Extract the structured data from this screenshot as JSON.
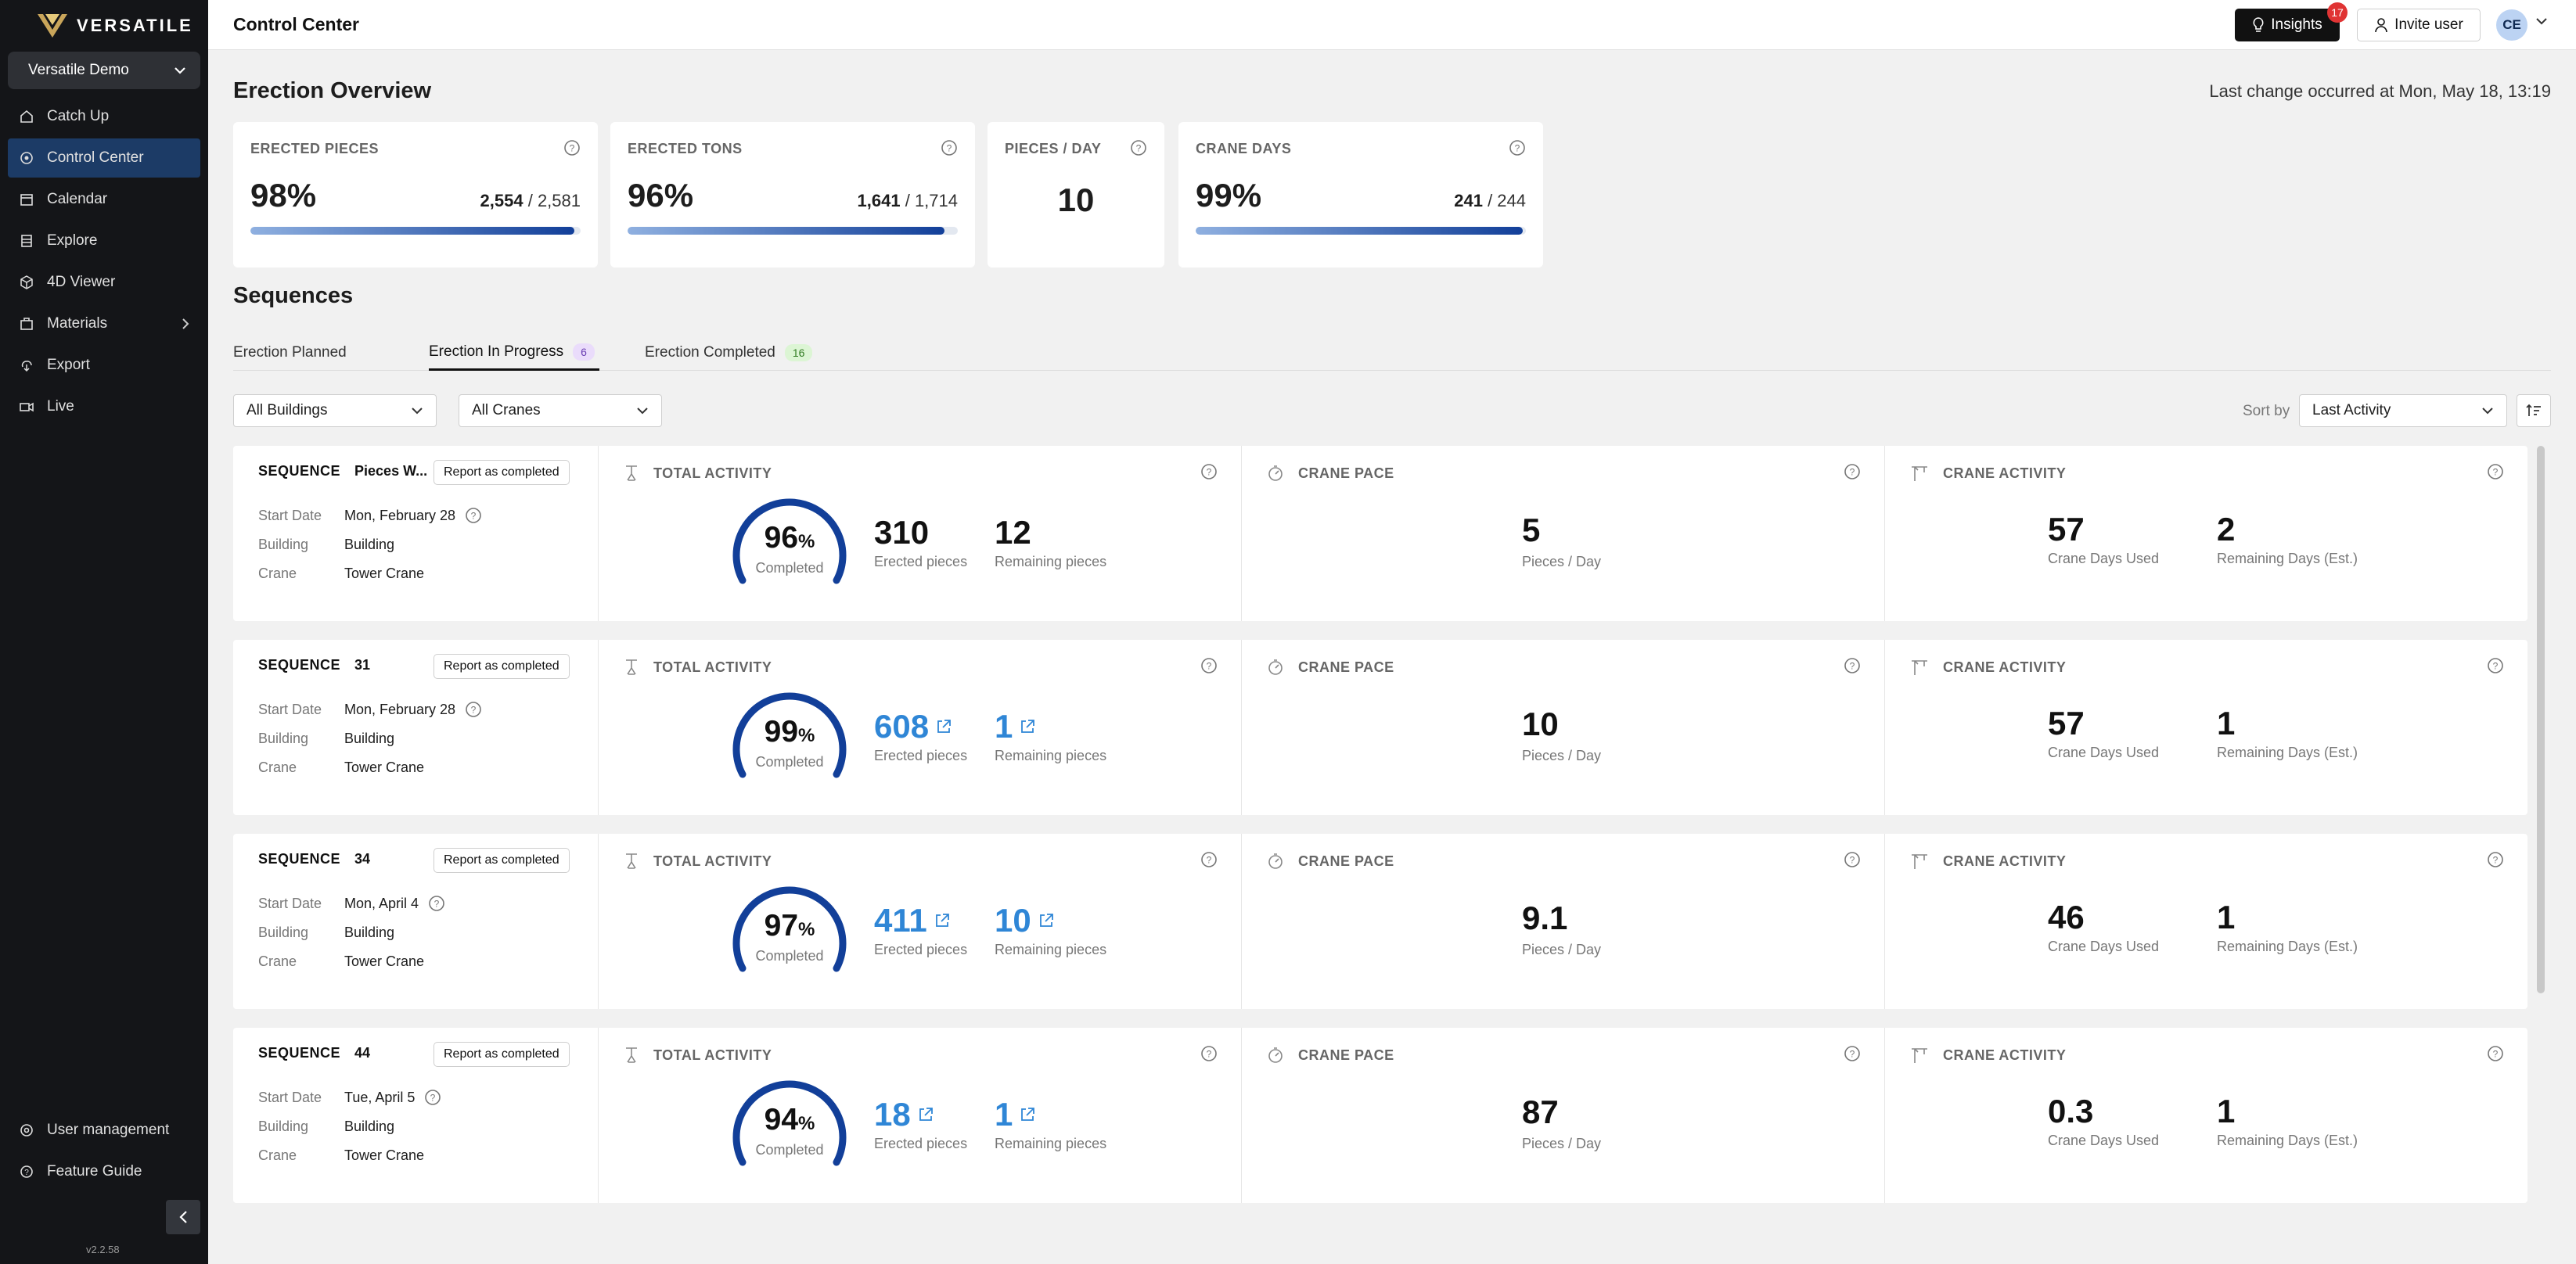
{
  "app": {
    "logo_text": "VERSATILE",
    "org": "Versatile Demo",
    "version": "v2.2.58"
  },
  "sidebar": {
    "items": [
      {
        "label": "Catch Up",
        "icon": "home-icon"
      },
      {
        "label": "Control Center",
        "icon": "target-icon",
        "active": true
      },
      {
        "label": "Calendar",
        "icon": "calendar-icon"
      },
      {
        "label": "Explore",
        "icon": "layers-icon"
      },
      {
        "label": "4D Viewer",
        "icon": "cube-icon"
      },
      {
        "label": "Materials",
        "icon": "materials-icon"
      },
      {
        "label": "Export",
        "icon": "export-icon"
      },
      {
        "label": "Live",
        "icon": "video-icon"
      }
    ],
    "bottom": [
      {
        "label": "User management",
        "icon": "gear-icon"
      },
      {
        "label": "Feature Guide",
        "icon": "help-circle-icon"
      }
    ]
  },
  "topbar": {
    "title": "Control Center",
    "insights_label": "Insights",
    "insights_count": "17",
    "invite_label": "Invite user",
    "avatar_initials": "CE"
  },
  "overview": {
    "heading": "Erection Overview",
    "last_change": "Last change occurred at Mon, May 18, 13:19",
    "cards": [
      {
        "label": "ERECTED PIECES",
        "pct": "98%",
        "done": "2,554",
        "total": " / 2,581",
        "progress": 0.98
      },
      {
        "label": "ERECTED TONS",
        "pct": "96%",
        "done": "1,641",
        "total": " / 1,714",
        "progress": 0.96
      },
      {
        "label": "PIECES / DAY",
        "value": "10"
      },
      {
        "label": "CRANE DAYS",
        "pct": "99%",
        "done": "241",
        "total": " / 244",
        "progress": 0.99
      }
    ]
  },
  "sequences": {
    "heading": "Sequences",
    "tabs": [
      {
        "label": "Erection Planned"
      },
      {
        "label": "Erection In Progress",
        "count": "6"
      },
      {
        "label": "Erection Completed",
        "count": "16"
      }
    ],
    "filters": {
      "buildings": "All Buildings",
      "cranes": "All Cranes",
      "sort_label": "Sort by",
      "sort_value": "Last Activity"
    },
    "labels": {
      "sequence": "SEQUENCE",
      "report_btn": "Report as completed",
      "start_date": "Start Date",
      "building": "Building",
      "crane": "Crane",
      "total_activity": "TOTAL ACTIVITY",
      "crane_pace": "CRANE PACE",
      "crane_activity": "CRANE ACTIVITY",
      "completed": "Completed",
      "erected_pieces": "Erected pieces",
      "remaining_pieces": "Remaining pieces",
      "pieces_per_day": "Pieces / Day",
      "crane_days_used": "Crane Days Used",
      "remaining_days": "Remaining Days (Est.)"
    },
    "rows": [
      {
        "name": "Pieces W...",
        "start": "Mon, February 28",
        "building": "Building",
        "crane": "Tower Crane",
        "completed_pct": "96",
        "progress": 0.96,
        "erected": "310",
        "remaining": "12",
        "linked": false,
        "pace": "5",
        "crane_days_used": "57",
        "remaining_days": "2"
      },
      {
        "name": "31",
        "start": "Mon, February 28",
        "building": "Building",
        "crane": "Tower Crane",
        "completed_pct": "99",
        "progress": 0.99,
        "erected": "608",
        "remaining": "1",
        "linked": true,
        "pace": "10",
        "crane_days_used": "57",
        "remaining_days": "1"
      },
      {
        "name": "34",
        "start": "Mon, April 4",
        "building": "Building",
        "crane": "Tower Crane",
        "completed_pct": "97",
        "progress": 0.97,
        "erected": "411",
        "remaining": "10",
        "linked": true,
        "pace": "9.1",
        "crane_days_used": "46",
        "remaining_days": "1"
      },
      {
        "name": "44",
        "start": "Tue, April 5",
        "building": "Building",
        "crane": "Tower Crane",
        "completed_pct": "94",
        "progress": 0.94,
        "erected": "18",
        "remaining": "1",
        "linked": true,
        "pace": "87",
        "crane_days_used": "0.3",
        "remaining_days": "1"
      }
    ]
  },
  "colors": {
    "accent": "#1c3b66",
    "link": "#2f86d6",
    "badge_red": "#e03434",
    "tab_purple_bg": "#eadcfb",
    "tab_green_bg": "#dcf5d4"
  }
}
